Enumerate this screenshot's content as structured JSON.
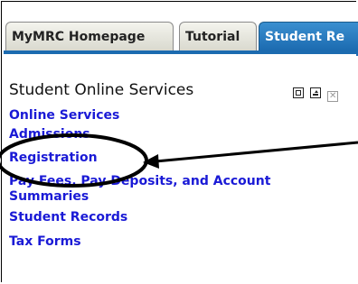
{
  "tabs": [
    {
      "label": "MyMRC Homepage",
      "active": false
    },
    {
      "label": "Tutorial",
      "active": false
    },
    {
      "label": "Student Re",
      "active": true
    }
  ],
  "portlet": {
    "title": "Student Online Services",
    "controls": [
      "maximize-icon",
      "minimize-icon",
      "close-icon"
    ]
  },
  "links": [
    "Online Services",
    "Admissions",
    "Registration",
    "Pay Fees, Pay Deposits, and Account Summaries",
    "Student Records",
    "Tax Forms"
  ],
  "colors": {
    "link": "#1a1ad6",
    "active_tab": "#1c6bb0",
    "annotation": "#000000"
  }
}
